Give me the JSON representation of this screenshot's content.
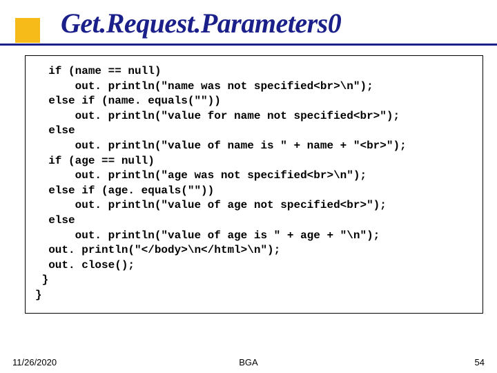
{
  "title": "Get.Request.Parameters0",
  "code": "  if (name == null)\n      out. println(\"name was not specified<br>\\n\");\n  else if (name. equals(\"\"))\n      out. println(\"value for name not specified<br>\");\n  else\n      out. println(\"value of name is \" + name + \"<br>\");\n  if (age == null)\n      out. println(\"age was not specified<br>\\n\");\n  else if (age. equals(\"\"))\n      out. println(\"value of age not specified<br>\");\n  else\n      out. println(\"value of age is \" + age + \"\\n\");\n  out. println(\"</body>\\n</html>\\n\");\n  out. close();\n }\n}",
  "footer": {
    "date": "11/26/2020",
    "center": "BGA",
    "page": "54"
  }
}
